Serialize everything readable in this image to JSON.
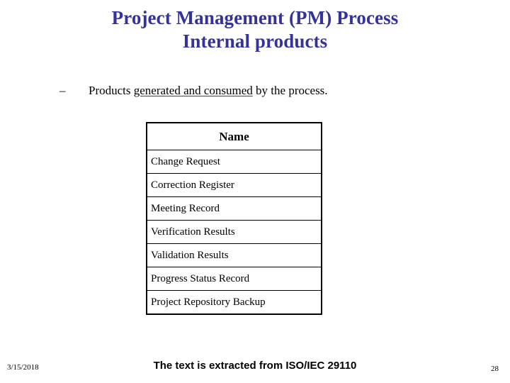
{
  "slide": {
    "title": {
      "line1": "Project Management (PM) Process",
      "line2": "Internal products",
      "color": "#333399"
    },
    "bullet": {
      "marker": "–",
      "prefix": "Products ",
      "highlight": "generated and consumed",
      "suffix": " by the process.",
      "underline_color": "#333399"
    },
    "table": {
      "header": "Name",
      "rows": [
        "Change Request",
        "Correction Register",
        "Meeting Record",
        "Verification Results",
        "Validation Results",
        "Progress Status Record",
        "Project Repository Backup"
      ]
    },
    "footer": {
      "date": "3/15/2018",
      "note": "The text is extracted from ISO/IEC 29110",
      "page_number": "28"
    }
  }
}
